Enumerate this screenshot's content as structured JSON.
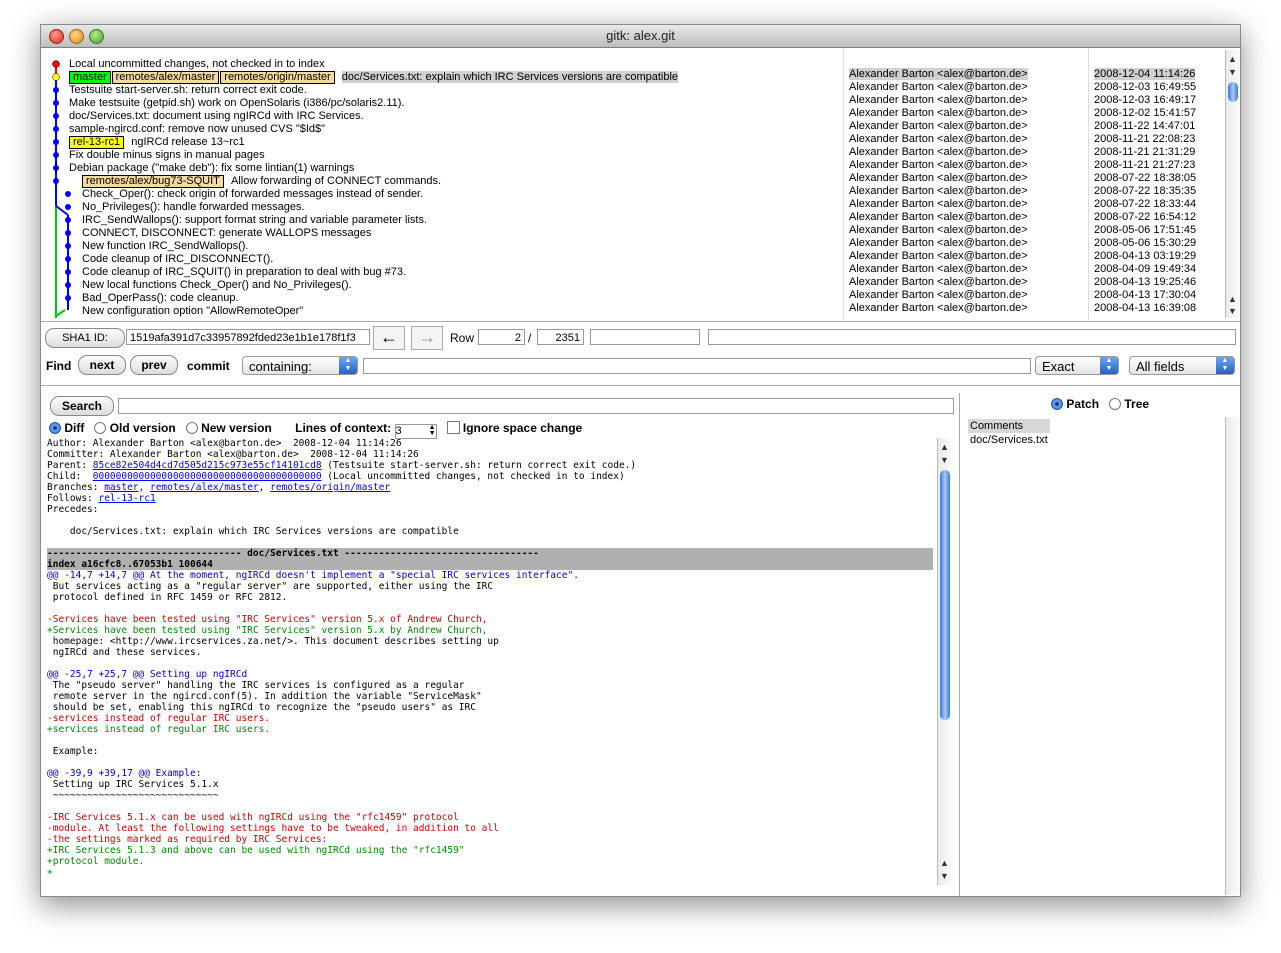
{
  "window": {
    "title": "gitk: alex.git"
  },
  "commits": [
    {
      "headline": "Local uncommitted changes, not checked in to index",
      "author": "",
      "date": "",
      "refs": [],
      "selected": false
    },
    {
      "headline": "doc/Services.txt: explain which IRC Services versions are compatible",
      "author": "Alexander Barton <alex@barton.de>",
      "date": "2008-12-04 11:14:26",
      "refs": [
        {
          "text": "master",
          "kind": "green"
        },
        {
          "text": "remotes/alex/master",
          "kind": "tan"
        },
        {
          "text": "remotes/origin/master",
          "kind": "tan"
        }
      ],
      "selected": true
    },
    {
      "headline": "Testsuite start-server.sh: return correct exit code.",
      "author": "Alexander Barton <alex@barton.de>",
      "date": "2008-12-03 16:49:55",
      "refs": [],
      "selected": false
    },
    {
      "headline": "Make testsuite (getpid.sh) work on OpenSolaris (i386/pc/solaris2.11).",
      "author": "Alexander Barton <alex@barton.de>",
      "date": "2008-12-03 16:49:17",
      "refs": [],
      "selected": false
    },
    {
      "headline": "doc/Services.txt: document using ngIRCd with IRC Services.",
      "author": "Alexander Barton <alex@barton.de>",
      "date": "2008-12-02 15:41:57",
      "refs": [],
      "selected": false
    },
    {
      "headline": "sample-ngircd.conf: remove now unused CVS \"$Id$\"",
      "author": "Alexander Barton <alex@barton.de>",
      "date": "2008-11-22 14:47:01",
      "refs": [],
      "selected": false
    },
    {
      "headline": "ngIRCd release 13~rc1",
      "author": "Alexander Barton <alex@barton.de>",
      "date": "2008-11-21 22:08:23",
      "refs": [
        {
          "text": "rel-13-rc1",
          "kind": "yellow"
        }
      ],
      "selected": false
    },
    {
      "headline": "Fix double minus signs in manual pages",
      "author": "Alexander Barton <alex@barton.de>",
      "date": "2008-11-21 21:31:29",
      "refs": [],
      "selected": false
    },
    {
      "headline": "Debian package (\"make deb\"): fix some lintian(1) warnings",
      "author": "Alexander Barton <alex@barton.de>",
      "date": "2008-11-21 21:27:23",
      "refs": [],
      "selected": false
    },
    {
      "headline": "Allow forwarding of CONNECT commands.",
      "author": "Alexander Barton <alex@barton.de>",
      "date": "2008-07-22 18:38:05",
      "refs": [
        {
          "text": "remotes/alex/bug73-SQUIT",
          "kind": "tan"
        }
      ],
      "selected": false
    },
    {
      "headline": "Check_Oper(): check origin of forwarded messages instead of sender.",
      "author": "Alexander Barton <alex@barton.de>",
      "date": "2008-07-22 18:35:35",
      "refs": [],
      "selected": false
    },
    {
      "headline": "No_Privileges(): handle forwarded messages.",
      "author": "Alexander Barton <alex@barton.de>",
      "date": "2008-07-22 18:33:44",
      "refs": [],
      "selected": false
    },
    {
      "headline": "IRC_SendWallops(): support format string and variable parameter lists.",
      "author": "Alexander Barton <alex@barton.de>",
      "date": "2008-07-22 16:54:12",
      "refs": [],
      "selected": false
    },
    {
      "headline": "CONNECT, DISCONNECT: generate WALLOPS messages",
      "author": "Alexander Barton <alex@barton.de>",
      "date": "2008-05-06 17:51:45",
      "refs": [],
      "selected": false
    },
    {
      "headline": "New function IRC_SendWallops().",
      "author": "Alexander Barton <alex@barton.de>",
      "date": "2008-05-06 15:30:29",
      "refs": [],
      "selected": false
    },
    {
      "headline": "Code cleanup of IRC_DISCONNECT().",
      "author": "Alexander Barton <alex@barton.de>",
      "date": "2008-04-13 03:19:29",
      "refs": [],
      "selected": false
    },
    {
      "headline": "Code cleanup of IRC_SQUIT() in preparation to deal with bug #73.",
      "author": "Alexander Barton <alex@barton.de>",
      "date": "2008-04-09 19:49:34",
      "refs": [],
      "selected": false
    },
    {
      "headline": "New local functions Check_Oper() and No_Privileges().",
      "author": "Alexander Barton <alex@barton.de>",
      "date": "2008-04-13 19:25:46",
      "refs": [],
      "selected": false
    },
    {
      "headline": "Bad_OperPass(): code cleanup.",
      "author": "Alexander Barton <alex@barton.de>",
      "date": "2008-04-13 17:30:04",
      "refs": [],
      "selected": false
    },
    {
      "headline": "New configuration option \"AllowRemoteOper\"",
      "author": "Alexander Barton <alex@barton.de>",
      "date": "2008-04-13 16:39:08",
      "refs": [],
      "selected": false
    }
  ],
  "sha": {
    "label": "SHA1 ID:",
    "value": "1519afa391d7c33957892fded23e1b1e178f1f3",
    "row_label": "Row",
    "row": "2",
    "row_sep": "/",
    "row_total": "2351"
  },
  "find": {
    "label": "Find",
    "next": "next",
    "prev": "prev",
    "commit": "commit",
    "mode": "containing:",
    "match": "Exact",
    "fields": "All fields"
  },
  "search": {
    "button": "Search"
  },
  "view": {
    "diff": "Diff",
    "old": "Old version",
    "new": "New version",
    "context_label": "Lines of context:",
    "context": "3",
    "ignore": "Ignore space change"
  },
  "filepane": {
    "patch": "Patch",
    "tree": "Tree",
    "items": [
      "Comments",
      "doc/Services.txt"
    ]
  },
  "commit_info": {
    "author": "Author: Alexander Barton <alex@barton.de>  2008-12-04 11:14:26",
    "committer": "Committer: Alexander Barton <alex@barton.de>  2008-12-04 11:14:26",
    "parent_label": "Parent: ",
    "parent_id": "85ce82e504d4cd7d505d215c973e55cf14101cd8",
    "parent_desc": " (Testsuite start-server.sh: return correct exit code.)",
    "child_label": "Child:  ",
    "child_id": "0000000000000000000000000000000000000000",
    "child_desc": " (Local uncommitted changes, not checked in to index)",
    "branches_label": "Branches: ",
    "branch1": "master",
    "branch2": "remotes/alex/master",
    "branch3": "remotes/origin/master",
    "follows_label": "Follows: ",
    "follows": "rel-13-rc1",
    "precedes": "Precedes:",
    "message": "    doc/Services.txt: explain which IRC Services versions are compatible"
  },
  "diff_lines": [
    {
      "t": "---------------------------------- doc/Services.txt ----------------------------------",
      "c": "hdr"
    },
    {
      "t": "index a16cfc8..67053b1 100644",
      "c": "hdr"
    },
    {
      "t": "@@ -14,7 +14,7 @@ At the moment, ngIRCd doesn't implement a \"special IRC services interface\".",
      "c": "blu"
    },
    {
      "t": " But services acting as a \"regular server\" are supported, either using the IRC",
      "c": ""
    },
    {
      "t": " protocol defined in RFC 1459 or RFC 2812.",
      "c": ""
    },
    {
      "t": " ",
      "c": ""
    },
    {
      "t": "-Services have been tested using \"IRC Services\" version 5.x of Andrew Church,",
      "c": "red"
    },
    {
      "t": "+Services have been tested using \"IRC Services\" version 5.x by Andrew Church,",
      "c": "grn"
    },
    {
      "t": " homepage: <http://www.ircservices.za.net/>. This document describes setting up",
      "c": ""
    },
    {
      "t": " ngIRCd and these services.",
      "c": ""
    },
    {
      "t": " ",
      "c": ""
    },
    {
      "t": "@@ -25,7 +25,7 @@ Setting up ngIRCd",
      "c": "blu"
    },
    {
      "t": " The \"pseudo server\" handling the IRC services is configured as a regular",
      "c": ""
    },
    {
      "t": " remote server in the ngircd.conf(5). In addition the variable \"ServiceMask\"",
      "c": ""
    },
    {
      "t": " should be set, enabling this ngIRCd to recognize the \"pseudo users\" as IRC",
      "c": ""
    },
    {
      "t": "-services instead of regular IRC users.",
      "c": "red"
    },
    {
      "t": "+services instead of regular IRC users.",
      "c": "grn"
    },
    {
      "t": " ",
      "c": ""
    },
    {
      "t": " Example:",
      "c": ""
    },
    {
      "t": " ",
      "c": ""
    },
    {
      "t": "@@ -39,9 +39,17 @@ Example:",
      "c": "blu"
    },
    {
      "t": " Setting up IRC Services 5.1.x",
      "c": ""
    },
    {
      "t": " ~~~~~~~~~~~~~~~~~~~~~~~~~~~~~",
      "c": ""
    },
    {
      "t": " ",
      "c": ""
    },
    {
      "t": "-IRC Services 5.1.x can be used with ngIRCd using the \"rfc1459\" protocol",
      "c": "red"
    },
    {
      "t": "-module. At least the following settings have to be tweaked, in addition to all",
      "c": "red"
    },
    {
      "t": "-the settings marked as required by IRC Services:",
      "c": "red"
    },
    {
      "t": "+IRC Services 5.1.3 and above can be used with ngIRCd using the \"rfc1459\"",
      "c": "grn"
    },
    {
      "t": "+protocol module.",
      "c": "grn"
    },
    {
      "t": "+",
      "c": "grn"
    }
  ]
}
